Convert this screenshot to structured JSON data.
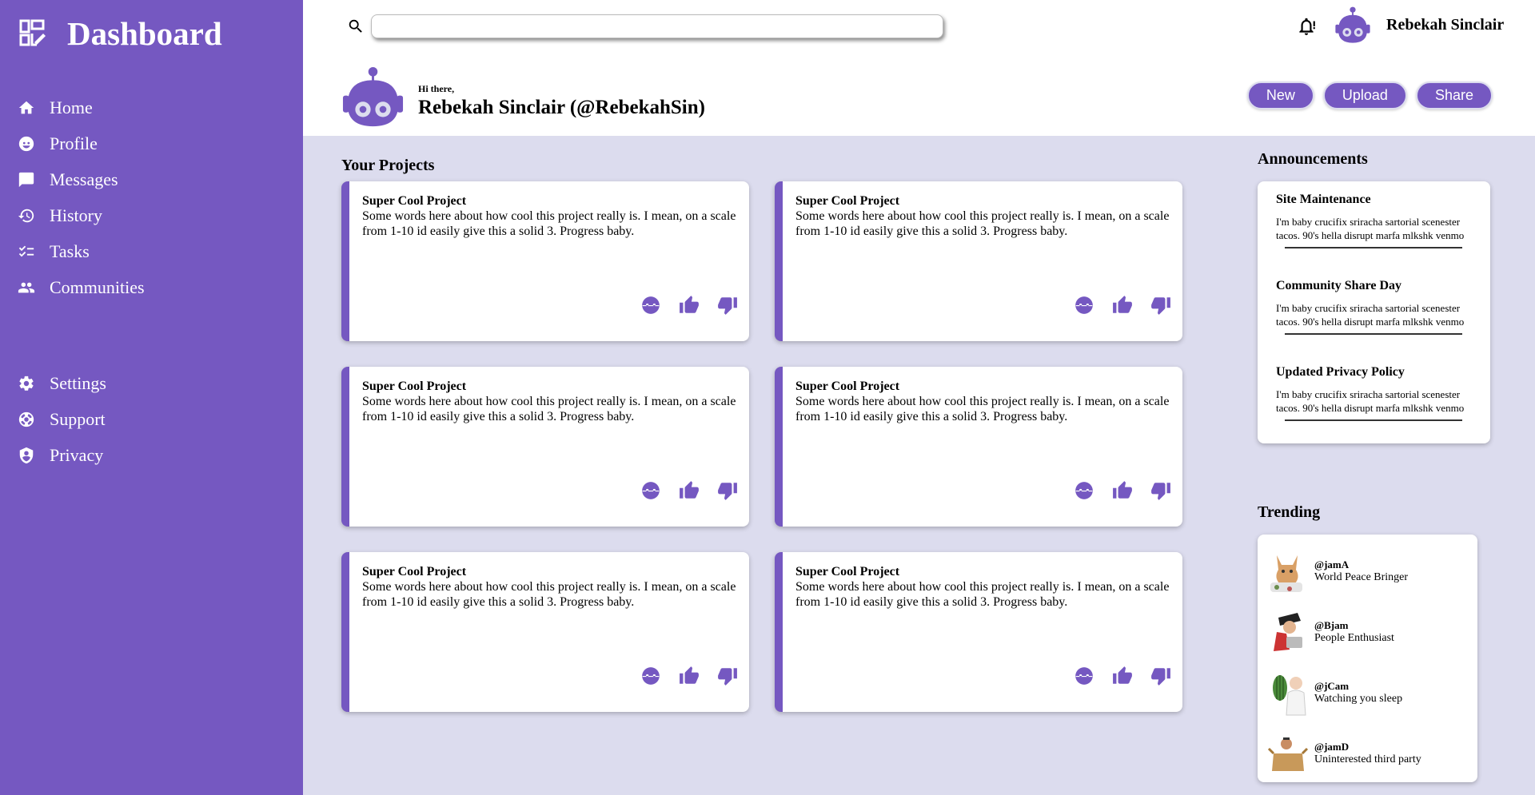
{
  "sidebar": {
    "title": "Dashboard",
    "nav_main": [
      {
        "label": "Home",
        "icon": "home-icon"
      },
      {
        "label": "Profile",
        "icon": "profile-icon"
      },
      {
        "label": "Messages",
        "icon": "messages-icon"
      },
      {
        "label": "History",
        "icon": "history-icon"
      },
      {
        "label": "Tasks",
        "icon": "tasks-icon"
      },
      {
        "label": "Communities",
        "icon": "communities-icon"
      }
    ],
    "nav_secondary": [
      {
        "label": "Settings",
        "icon": "gear-icon"
      },
      {
        "label": "Support",
        "icon": "support-icon"
      },
      {
        "label": "Privacy",
        "icon": "shield-icon"
      }
    ]
  },
  "header": {
    "search": {
      "value": "",
      "placeholder": ""
    },
    "username": "Rebekah Sinclair",
    "greeting": "Hi there,",
    "display_name": "Rebekah Sinclair (@RebekahSin)",
    "actions": [
      "New",
      "Upload",
      "Share"
    ]
  },
  "projects": {
    "title": "Your Projects",
    "cards": [
      {
        "title": "Super Cool Project",
        "description": "Some words here about how cool this project really is. I mean, on a scale from 1-10 id easily give this a solid 3. Progress baby."
      },
      {
        "title": "Super Cool Project",
        "description": "Some words here about how cool this project really is. I mean, on a scale from 1-10 id easily give this a solid 3. Progress baby."
      },
      {
        "title": "Super Cool Project",
        "description": "Some words here about how cool this project really is. I mean, on a scale from 1-10 id easily give this a solid 3. Progress baby."
      },
      {
        "title": "Super Cool Project",
        "description": "Some words here about how cool this project really is. I mean, on a scale from 1-10 id easily give this a solid 3. Progress baby."
      },
      {
        "title": "Super Cool Project",
        "description": "Some words here about how cool this project really is. I mean, on a scale from 1-10 id easily give this a solid 3. Progress baby."
      },
      {
        "title": "Super Cool Project",
        "description": "Some words here about how cool this project really is. I mean, on a scale from 1-10 id easily give this a solid 3. Progress baby."
      }
    ]
  },
  "announcements": {
    "title": "Announcements",
    "items": [
      {
        "title": "Site Maintenance",
        "text": "I'm baby crucifix sriracha sartorial scenester tacos. 90's hella disrupt marfa mlkshk venmo"
      },
      {
        "title": "Community Share Day",
        "text": "I'm baby crucifix sriracha sartorial scenester tacos. 90's hella disrupt marfa mlkshk venmo"
      },
      {
        "title": "Updated Privacy Policy",
        "text": "I'm baby crucifix sriracha sartorial scenester tacos. 90's hella disrupt marfa mlkshk venmo"
      }
    ]
  },
  "trending": {
    "title": "Trending",
    "items": [
      {
        "handle": "@jamA",
        "subtitle": "World Peace Bringer"
      },
      {
        "handle": "@Bjam",
        "subtitle": "People Enthusiast"
      },
      {
        "handle": "@jCam",
        "subtitle": "Watching you sleep"
      },
      {
        "handle": "@jamD",
        "subtitle": "Uninterested third party"
      }
    ]
  },
  "colors": {
    "accent": "#7558c1",
    "background": "#dcdcee"
  }
}
